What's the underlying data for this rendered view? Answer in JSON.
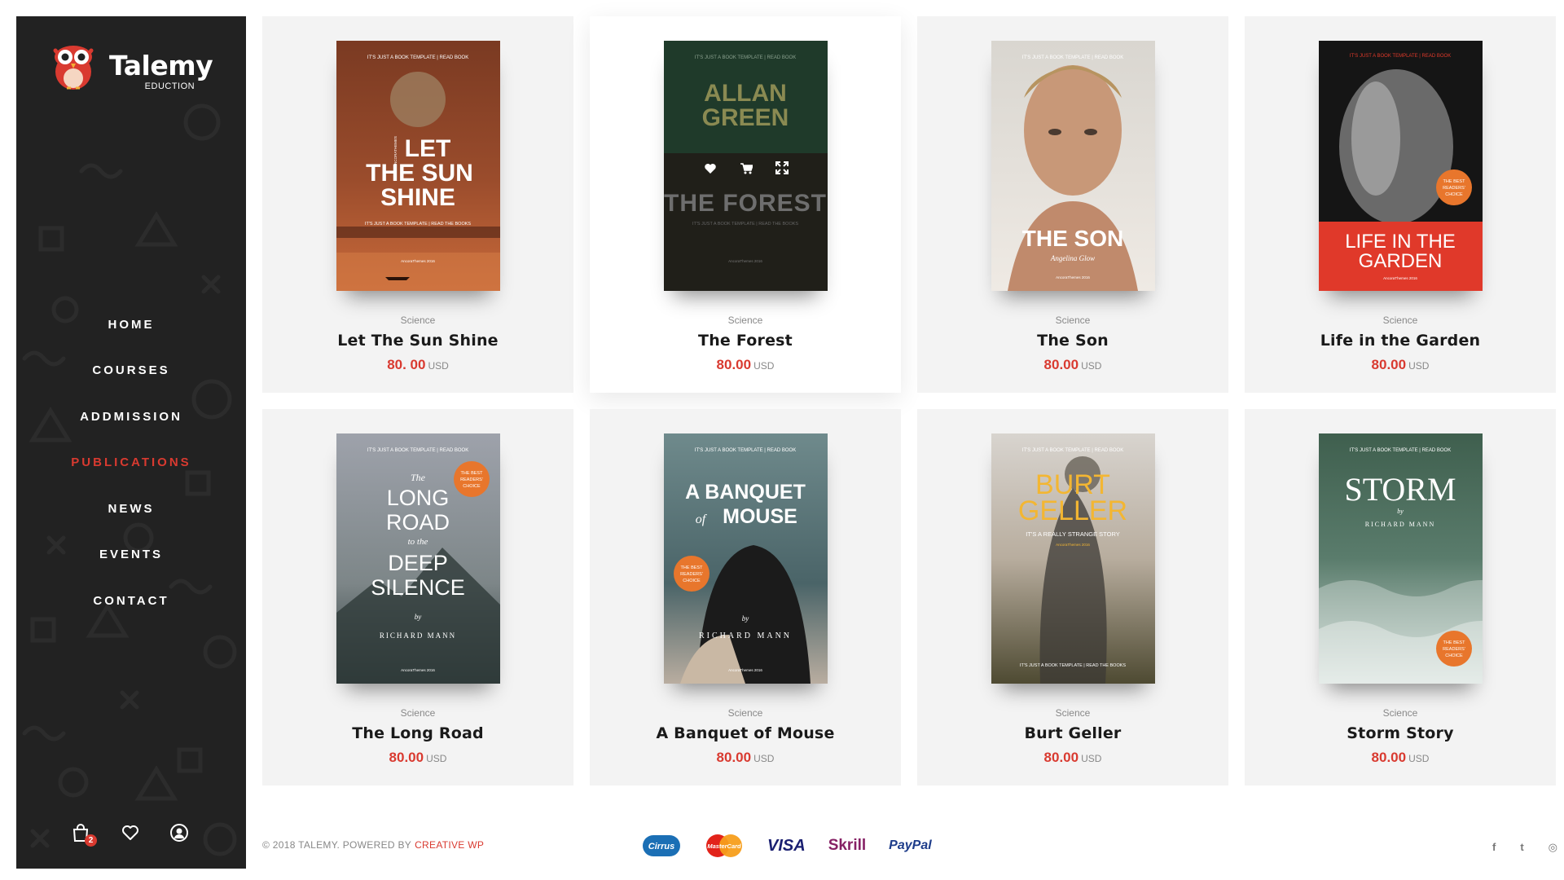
{
  "brand": {
    "name": "Talemy",
    "tagline": "EDUCTION"
  },
  "nav": {
    "items": [
      {
        "label": "HOME"
      },
      {
        "label": "COURSES"
      },
      {
        "label": "ADDMISSION"
      },
      {
        "label": "PUBLICATIONS"
      },
      {
        "label": "NEWS"
      },
      {
        "label": "EVENTS"
      },
      {
        "label": "CONTACT"
      }
    ],
    "active_index": 3
  },
  "sidebar_icons": {
    "cart_icon": "shopping-bag-icon",
    "cart_count": "2",
    "wishlist_icon": "heart-icon",
    "account_icon": "user-icon"
  },
  "products": [
    {
      "category": "Science",
      "title": "Let The Sun Shine",
      "price": "80. 00",
      "currency": "USD",
      "cover": {
        "top_line": "IT'S JUST A BOOK TEMPLATE  |  READ BOOK",
        "title_lines": [
          "LET",
          "THE SUN",
          "SHINE"
        ],
        "bottom_line": "IT'S JUST A BOOK TEMPLATE  |  READ THE BOOKS",
        "credit": "AncoraThemes 2016",
        "side_text": "ANCORATHEMES"
      }
    },
    {
      "category": "Science",
      "title": "The Forest",
      "price": "80.00",
      "currency": "USD",
      "cover": {
        "top_line": "IT'S JUST A BOOK TEMPLATE  |  READ BOOK",
        "author_lines": [
          "ALLAN",
          "GREEN"
        ],
        "title_lines": [
          "THE FOREST"
        ],
        "bottom_line": "IT'S JUST A BOOK TEMPLATE  |  READ THE BOOKS",
        "credit": "AncoraThemes 2016"
      },
      "hover_actions": [
        "heart-icon",
        "cart-icon",
        "expand-icon"
      ]
    },
    {
      "category": "Science",
      "title": "The Son",
      "price": "80.00",
      "currency": "USD",
      "cover": {
        "top_line": "IT'S JUST A BOOK TEMPLATE  |  READ BOOK",
        "title_lines": [
          "THE SON"
        ],
        "author": "Angelina Glow",
        "credit": "AncoraThemes 2016"
      }
    },
    {
      "category": "Science",
      "title": "Life in the Garden",
      "price": "80.00",
      "currency": "USD",
      "cover": {
        "top_line": "IT'S JUST A BOOK TEMPLATE  |  READ BOOK",
        "title_lines": [
          "LIFE IN THE",
          "GARDEN"
        ],
        "badge_lines": [
          "THE BEST",
          "READERS'",
          "CHOICE"
        ],
        "credit": "AncoraThemes 2016"
      }
    },
    {
      "category": "Science",
      "title": "The Long Road",
      "price": "80.00",
      "currency": "USD",
      "cover": {
        "top_line": "IT'S JUST A BOOK TEMPLATE  |  READ BOOK",
        "small_1": "The",
        "title_1": "LONG",
        "title_2": "ROAD",
        "small_2": "to the",
        "title_3": "DEEP",
        "title_4": "SILENCE",
        "by": "by",
        "author": "RICHARD MANN",
        "badge_lines": [
          "THE BEST",
          "READERS'",
          "CHOICE"
        ],
        "credit": "AncoraThemes 2016"
      }
    },
    {
      "category": "Science",
      "title": "A Banquet of Mouse",
      "price": "80.00",
      "currency": "USD",
      "cover": {
        "top_line": "IT'S JUST A BOOK TEMPLATE  |  READ BOOK",
        "title_1": "A BANQUET",
        "of": "of",
        "title_2": "MOUSE",
        "by": "by",
        "author": "RICHARD MANN",
        "badge_lines": [
          "THE BEST",
          "READERS'",
          "CHOICE"
        ],
        "credit": "AncoraThemes 2016"
      }
    },
    {
      "category": "Science",
      "title": "Burt Geller",
      "price": "80.00",
      "currency": "USD",
      "cover": {
        "top_line": "IT'S JUST A BOOK TEMPLATE  |  READ BOOK",
        "title_lines": [
          "BURT",
          "GELLER"
        ],
        "subtitle": "IT'S A REALLY STRANGE STORY",
        "credit": "AncoraThemes 2016",
        "bottom_line": "IT'S JUST A BOOK TEMPLATE  |  READ THE BOOKS"
      }
    },
    {
      "category": "Science",
      "title": "Storm Story",
      "price": "80.00",
      "currency": "USD",
      "cover": {
        "top_line": "IT'S JUST A BOOK TEMPLATE  |  READ BOOK",
        "title_lines": [
          "STORM"
        ],
        "by": "by",
        "author": "RICHARD MANN",
        "badge_lines": [
          "THE BEST",
          "READERS'",
          "CHOICE"
        ]
      }
    }
  ],
  "footer": {
    "copyright": "© 2018 TALEMY.  POWERED BY",
    "powered_by": "CREATIVE WP",
    "payments": [
      "Cirrus",
      "MasterCard",
      "VISA",
      "Skrill",
      "PayPal"
    ],
    "socials": [
      {
        "label": "f",
        "icon": "facebook-icon"
      },
      {
        "label": "t",
        "icon": "twitter-icon"
      },
      {
        "label": "◎",
        "icon": "instagram-icon"
      }
    ]
  },
  "colors": {
    "accent": "#d93a30",
    "sidebar_bg": "#222222",
    "card_bg": "#f3f3f3"
  }
}
